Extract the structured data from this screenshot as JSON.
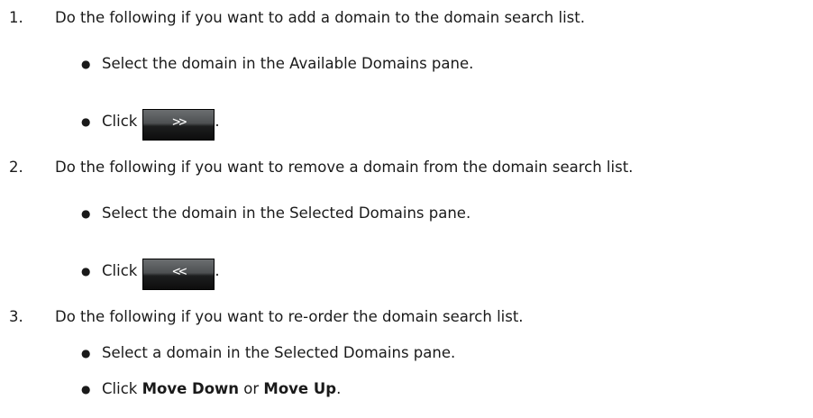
{
  "steps": [
    {
      "number": "1.",
      "text": "Do the following if you want to add a domain to the domain search list.",
      "sub": [
        {
          "text": "Select the domain in the Available Domains pane."
        },
        {
          "prefix": "Click",
          "button_glyph": ">>",
          "suffix": "."
        }
      ]
    },
    {
      "number": "2.",
      "text": "Do the following if you want to remove a domain from the domain search list.",
      "sub": [
        {
          "text": "Select the domain in the Selected Domains pane."
        },
        {
          "prefix": "Click",
          "button_glyph": "<<",
          "suffix": "."
        }
      ]
    },
    {
      "number": "3.",
      "text": "Do the following if you want to re-order the domain search list.",
      "sub": [
        {
          "text": "Select a domain in the Selected Domains pane."
        },
        {
          "prefix": "Click ",
          "bold1": "Move Down",
          "middle": " or ",
          "bold2": "Move Up",
          "suffix": "."
        }
      ]
    }
  ],
  "bullet_glyph": "●"
}
